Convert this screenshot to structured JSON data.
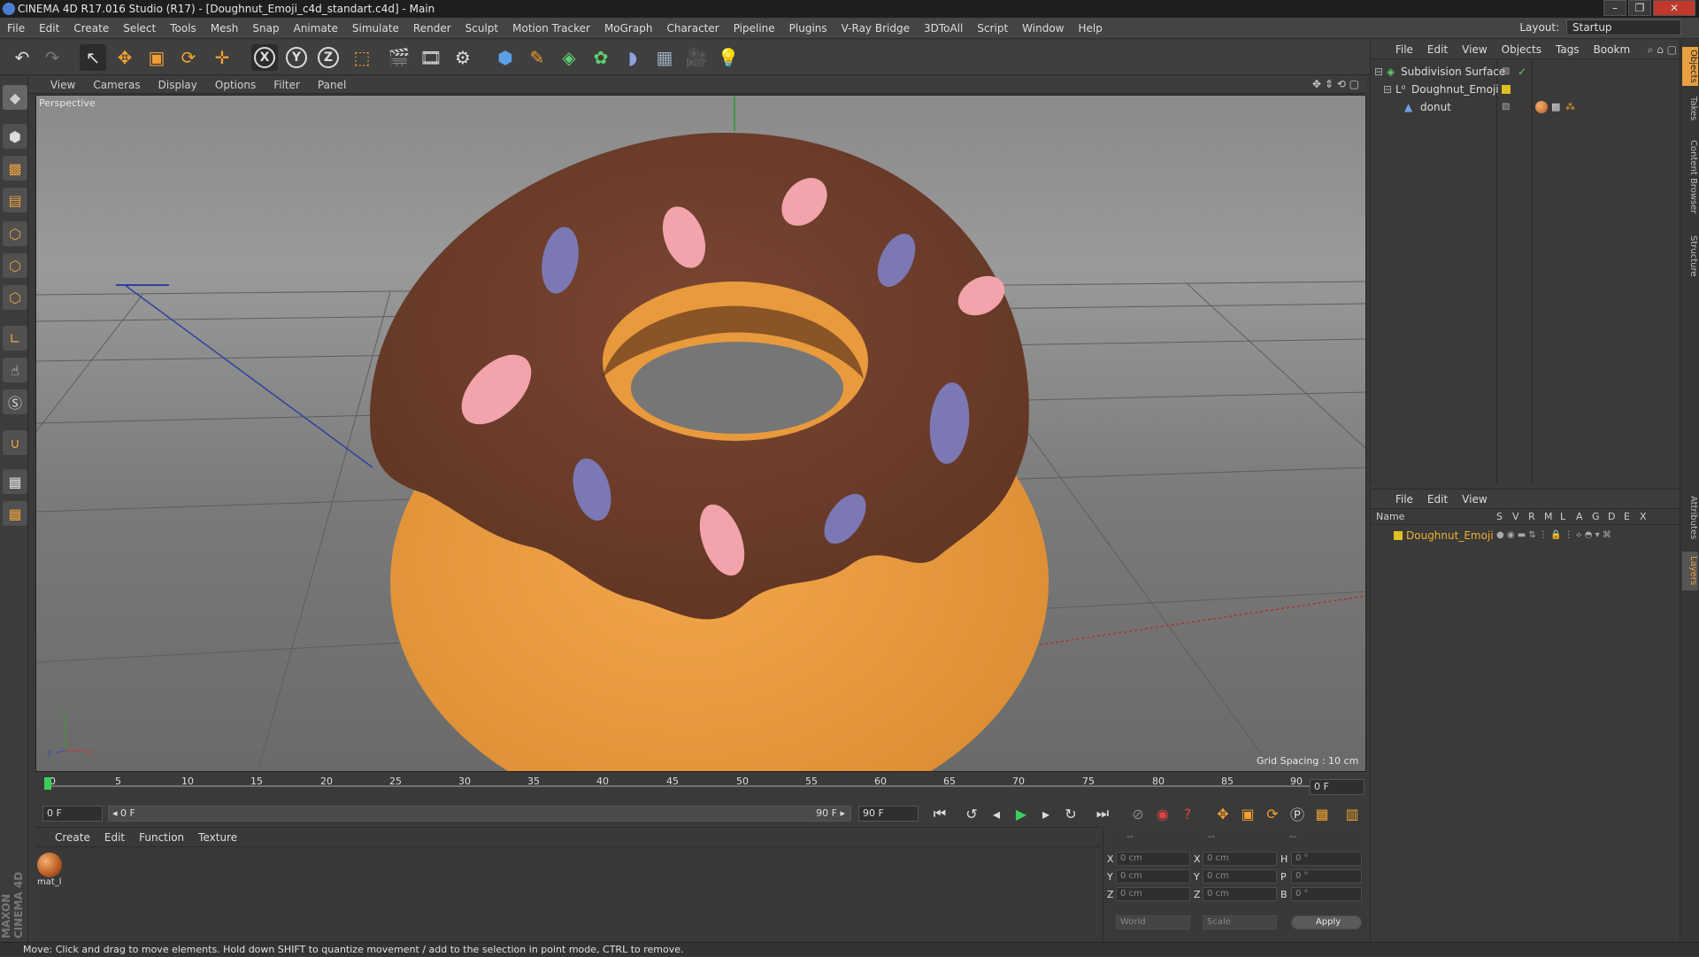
{
  "window": {
    "title": "CINEMA 4D R17.016 Studio (R17) - [Doughnut_Emoji_c4d_standart.c4d] - Main",
    "controls": [
      "–",
      "❐",
      "✕"
    ]
  },
  "menubar": {
    "items": [
      "File",
      "Edit",
      "Create",
      "Select",
      "Tools",
      "Mesh",
      "Snap",
      "Animate",
      "Simulate",
      "Render",
      "Sculpt",
      "Motion Tracker",
      "MoGraph",
      "Character",
      "Pipeline",
      "Plugins",
      "V-Ray Bridge",
      "3DToAll",
      "Script",
      "Window",
      "Help"
    ],
    "layout_label": "Layout:",
    "layout_value": "Startup"
  },
  "toolbar": {
    "axis_x": "X",
    "axis_y": "Y",
    "axis_z": "Z"
  },
  "viewport": {
    "menu": [
      "View",
      "Cameras",
      "Display",
      "Options",
      "Filter",
      "Panel"
    ],
    "label": "Perspective",
    "grid_spacing": "Grid Spacing : 10 cm"
  },
  "timeline": {
    "ticks": [
      "0",
      "5",
      "10",
      "15",
      "20",
      "25",
      "30",
      "35",
      "40",
      "45",
      "50",
      "55",
      "60",
      "65",
      "70",
      "75",
      "80",
      "85",
      "90"
    ],
    "current_frame": "0 F",
    "start_field": "0 F",
    "range_start": "◂ 0 F",
    "range_end": "90 F ▸",
    "end_field": "90 F"
  },
  "material_panel": {
    "menu": [
      "Create",
      "Edit",
      "Function",
      "Texture"
    ],
    "material_name": "mat_l"
  },
  "coord_panel": {
    "header": [
      "--",
      "--",
      "--"
    ],
    "rows": [
      {
        "a": "X",
        "av": "0 cm",
        "b": "X",
        "bv": "0 cm",
        "c": "H",
        "cv": "0 °"
      },
      {
        "a": "Y",
        "av": "0 cm",
        "b": "Y",
        "bv": "0 cm",
        "c": "P",
        "cv": "0 °"
      },
      {
        "a": "Z",
        "av": "0 cm",
        "b": "Z",
        "bv": "0 cm",
        "c": "B",
        "cv": "0 °"
      }
    ],
    "world": "World",
    "scale": "Scale",
    "apply": "Apply"
  },
  "objects_panel": {
    "menu": [
      "File",
      "Edit",
      "View",
      "Objects",
      "Tags",
      "Bookm"
    ],
    "objects": [
      "Subdivision Surface",
      "Doughnut_Emoji",
      "donut"
    ]
  },
  "layers_panel": {
    "menu": [
      "File",
      "Edit",
      "View"
    ],
    "columns": [
      "Name",
      "S",
      "V",
      "R",
      "M",
      "L",
      "A",
      "G",
      "D",
      "E",
      "X"
    ],
    "layer": "Doughnut_Emoji"
  },
  "right_tabs": [
    "Objects",
    "Takes",
    "Content Browser",
    "Structure",
    "Attributes",
    "Layers"
  ],
  "statusbar": {
    "text": "Move: Click and drag to move elements. Hold down SHIFT to quantize movement / add to the selection in point mode, CTRL to remove."
  },
  "brand": "MAXON CINEMA 4D",
  "colors": {
    "frosting": "#6f3f2c",
    "dough": "#e99a3e",
    "sprinkle_pink": "#f2a3ab",
    "sprinkle_purple": "#7b78b4",
    "layer_yellow": "#e0c020",
    "layer_text": "#f0b030"
  }
}
